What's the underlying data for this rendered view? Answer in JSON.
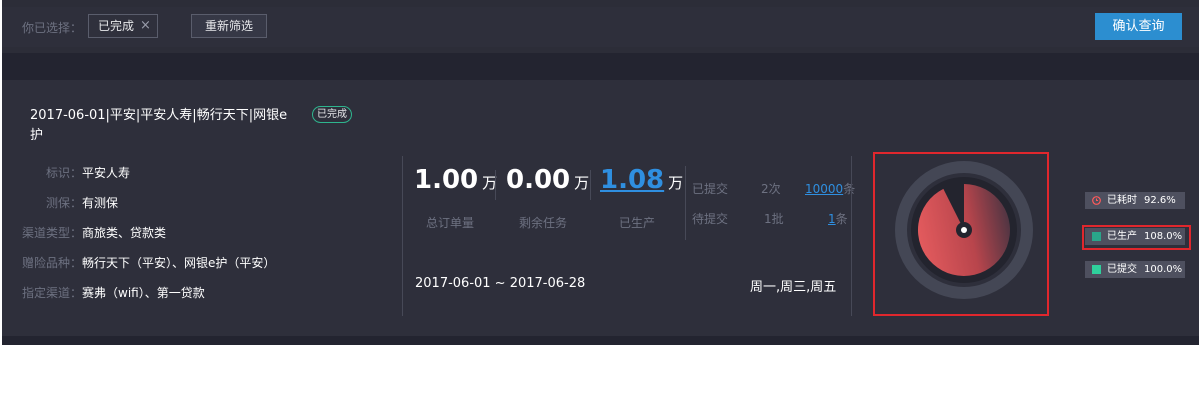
{
  "filter": {
    "selected_label": "你已选择：",
    "tag_text": "已完成",
    "tag_close": "×",
    "reset_label": "重新筛选",
    "confirm_label": "确认查询"
  },
  "order": {
    "title": "2017-06-01|平安|平安人寿|畅行天下|网银e护",
    "status": "已完成",
    "attributes": [
      {
        "key": "标识：",
        "value": "平安人寿"
      },
      {
        "key": "测保：",
        "value": "有测保"
      },
      {
        "key": "渠道类型：",
        "value": "商旅类、贷款类"
      },
      {
        "key": "赠险品种：",
        "value": "畅行天下（平安）、网银e护（平安）"
      },
      {
        "key": "指定渠道：",
        "value": "赛弗（wifi）、第一贷款"
      }
    ],
    "stats": [
      {
        "value": "1.00",
        "unit": "万",
        "label": "总订单量"
      },
      {
        "value": "0.00",
        "unit": "万",
        "label": "剩余任务"
      },
      {
        "value": "1.08",
        "unit": "万",
        "label": "已生产"
      }
    ],
    "submitted": {
      "label": "已提交",
      "times": "2次",
      "count": "10000",
      "count_unit": "条"
    },
    "pending": {
      "label": "待提交",
      "batches": "1批",
      "count": "1",
      "count_unit": "条"
    },
    "date_range": "2017-06-01 ~ 2017-06-28",
    "weekdays": "周一,周三,周五"
  },
  "gauge": {
    "time_used_pct": 92.6,
    "colors": {
      "ring": "#444755",
      "inner_bg": "#23242e",
      "pie_a": "#e25a5d",
      "pie_b": "#4a3442"
    }
  },
  "legend": [
    {
      "label": "已耗时",
      "value": "92.6%",
      "color": "#ff5a5a",
      "icon": "clock-icon"
    },
    {
      "label": "已生产",
      "value": "108.0%",
      "color": "#2aa58a",
      "icon": "square-icon"
    },
    {
      "label": "已提交",
      "value": "100.0%",
      "color": "#2fd09c",
      "icon": "square-icon"
    }
  ]
}
